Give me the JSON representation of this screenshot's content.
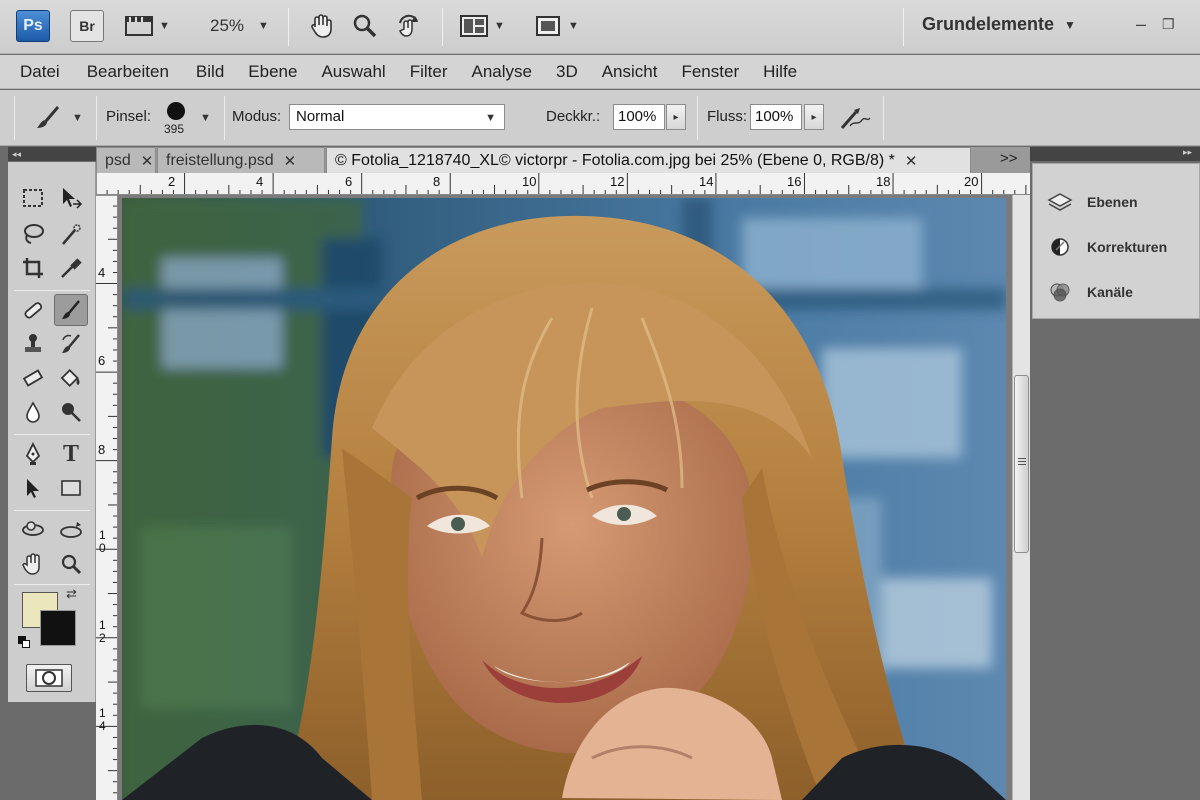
{
  "appbar": {
    "ps_logo": "Ps",
    "br_logo": "Br",
    "zoom": "25%",
    "workspace": "Grundelemente",
    "icons": [
      "frame-icon",
      "hand-icon",
      "zoom-icon",
      "rotate-view-icon",
      "arrange-documents-icon",
      "screen-mode-icon"
    ]
  },
  "menu": [
    "Datei",
    "Bearbeiten",
    "Bild",
    "Ebene",
    "Auswahl",
    "Filter",
    "Analyse",
    "3D",
    "Ansicht",
    "Fenster",
    "Hilfe"
  ],
  "options": {
    "brush_label": "Pinsel:",
    "brush_size": "395",
    "mode_label": "Modus:",
    "mode_value": "Normal",
    "opacity_label": "Deckkr.:",
    "opacity_value": "100%",
    "flow_label": "Fluss:",
    "flow_value": "100%"
  },
  "tabs": [
    {
      "label": "psd"
    },
    {
      "label": "freistellung.psd"
    },
    {
      "label": "© Fotolia_1218740_XL© victorpr - Fotolia.com.jpg bei 25% (Ebene 0, RGB/8) *"
    }
  ],
  "tabs_overflow": ">>",
  "ruler": {
    "top": [
      "2",
      "4",
      "6",
      "8",
      "10",
      "12",
      "14",
      "16",
      "18",
      "20"
    ],
    "left": [
      "4",
      "6",
      "8",
      "1 0",
      "1 2",
      "1 4"
    ]
  },
  "panels": [
    {
      "label": "Ebenen",
      "icon": "layers-icon"
    },
    {
      "label": "Korrekturen",
      "icon": "adjustments-icon"
    },
    {
      "label": "Kanäle",
      "icon": "channels-icon"
    }
  ],
  "colors": {
    "foreground": "#ece6bd",
    "background": "#111111"
  },
  "panel_collapse": "◂◂"
}
